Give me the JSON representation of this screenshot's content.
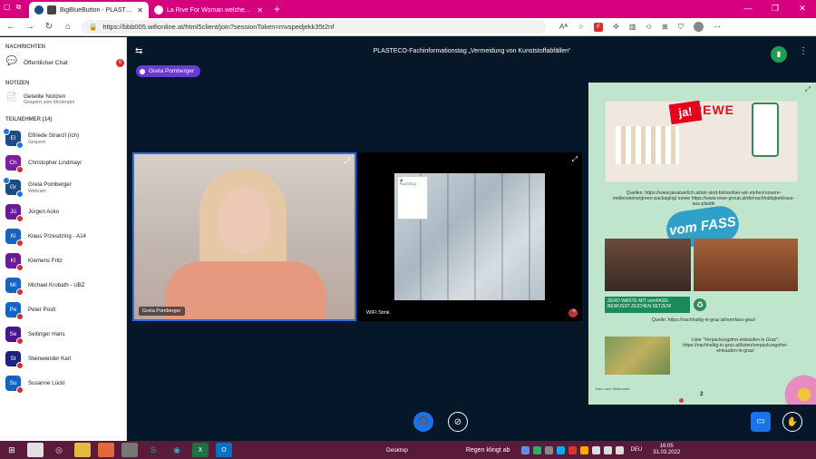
{
  "browser": {
    "tabs": [
      {
        "label": "BigBlueButton - PLASTECO-",
        "active": true
      },
      {
        "label": "La Rive For Woman welches Oris",
        "active": false
      }
    ],
    "url": "https://bbb005.wifionline.at/html5client/join?sessionToken=mvspedjekk35t2nf",
    "new_tab": "+"
  },
  "sidebar": {
    "messages_heading": "NACHRICHTEN",
    "public_chat": {
      "label": "Öffentlicher Chat",
      "unread": "6"
    },
    "notes_heading": "NOTIZEN",
    "shared_notes": {
      "label": "Geteilte Notizen",
      "sub": "Gesperrt vom Moderator"
    },
    "participants_heading": "TEILNEHMER (14)",
    "participants": [
      {
        "initials": "El",
        "name": "Elfriede Stranzl (Ich)",
        "sub": "Gesperrt",
        "color": "#1a4c8a"
      },
      {
        "initials": "Ch",
        "name": "Christopher Lindmayr",
        "sub": "",
        "color": "#7b1fa2"
      },
      {
        "initials": "Gr",
        "name": "Greta Pomberger",
        "sub": "Webcam",
        "color": "#1a4c8a"
      },
      {
        "initials": "Jü",
        "name": "Jürgen Acko",
        "sub": "",
        "color": "#6a1b9a"
      },
      {
        "initials": "Kl",
        "name": "Klaus Przesdzing - A14",
        "sub": "",
        "color": "#1565c0"
      },
      {
        "initials": "Kl",
        "name": "Klemens Fritz",
        "sub": "",
        "color": "#6a1b9a"
      },
      {
        "initials": "Mi",
        "name": "Michael Krobath - UBZ",
        "sub": "",
        "color": "#1565c0"
      },
      {
        "initials": "Pe",
        "name": "Peter Postl",
        "sub": "",
        "color": "#1565c0"
      },
      {
        "initials": "Se",
        "name": "Seitinger Hans",
        "sub": "",
        "color": "#4a148c"
      },
      {
        "initials": "St",
        "name": "Steinwender Karl",
        "sub": "",
        "color": "#1a237e"
      },
      {
        "initials": "Su",
        "name": "Susanne Lückl",
        "sub": "",
        "color": "#1565c0"
      }
    ]
  },
  "meeting": {
    "title": "PLASTECO-Fachinformationstag „Vermeidung von Kunststoffabfällen“",
    "talker": "Greta Pomberger",
    "videos": [
      {
        "name": "Greta Pomberger"
      },
      {
        "name": "WIFI Stmk"
      }
    ]
  },
  "presentation": {
    "source1": "Quellen: https://www.janatuerlich.at/wir-sind-bio/wofuer-wir-stehen/unsere-meilensteine/green-packaging/ sowie https://www.rewe-group.at/de/nachhaltigkeit/raus-aus-plastik",
    "zero_waste": "ZERO WASTE MIT vomFASS- BEWUSST ZEICHEN SETZEN!",
    "source2": "Quelle: https://nachhaltig-in-graz.at/vomfass-graz/",
    "source3": "Liste \"Verpackungsfrei einkaufen in Graz\": https://nachhaltig-in-graz.at/listen/verpackungsfrei-einkaufen-in-graz/",
    "page": "2",
    "brand1": "ja!",
    "brand2": "REWE",
    "brand3": "vom FASS",
    "land_logo": "Das Land Steiermark"
  },
  "taskbar": {
    "desktop": "Desktop",
    "song": "Regen klingt ab",
    "lang": "DEU",
    "time": "16:05",
    "date": "31.03.2022"
  }
}
